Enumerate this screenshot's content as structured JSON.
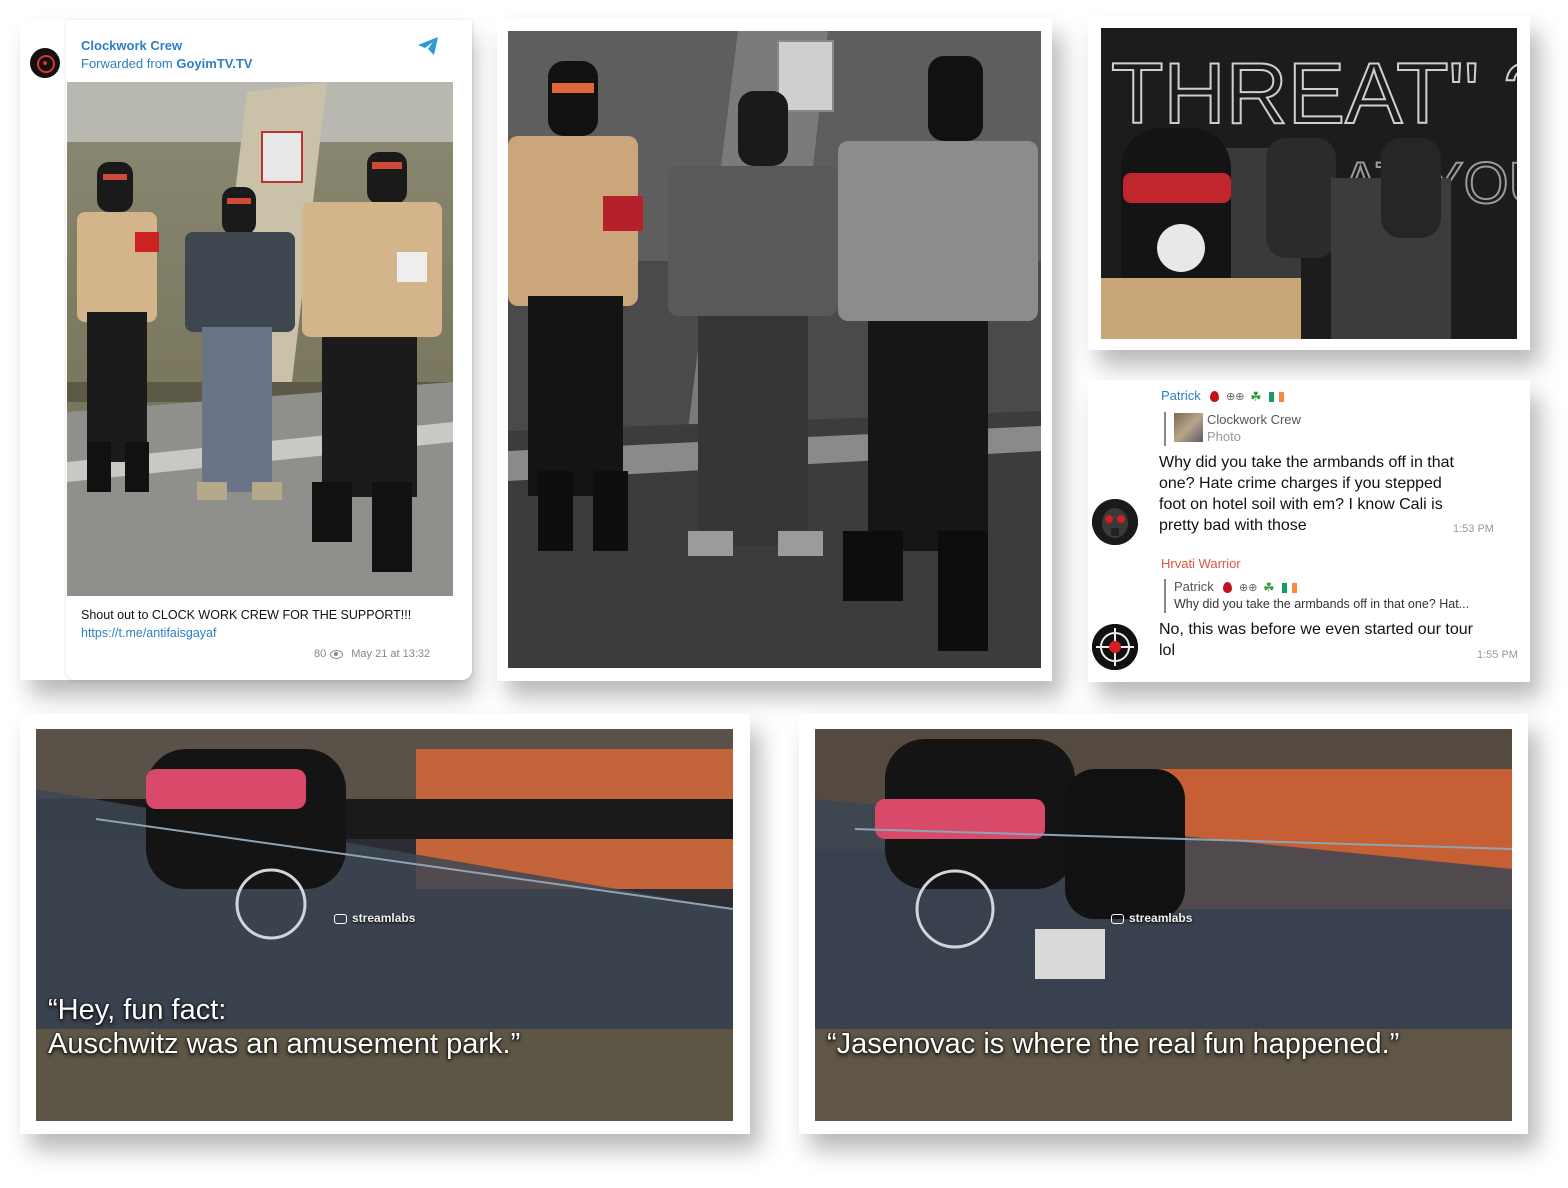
{
  "telegram_post": {
    "channel": "Clockwork Crew",
    "forwarded_prefix": "Forwarded from ",
    "forwarded_source": "GoyimTV.TV",
    "text": "Shout out to CLOCK WORK CREW FOR THE SUPPORT!!!",
    "link": "https://t.me/antifaisgayaf",
    "views": "80",
    "date": "May 21 at 13:32",
    "icons": {
      "avatar": "crosshair-avatar-icon",
      "app": "telegram-plane-icon",
      "views": "eye-icon"
    }
  },
  "photos": {
    "grayscale_group": "",
    "selfie_wall_text": "THREAT\" ?"
  },
  "chat": {
    "msg1": {
      "sender": "Patrick",
      "sender_color": "#2c7fc6",
      "sender_symbols": "⊕⊕",
      "reply_to_name": "Clockwork Crew",
      "reply_to_type": "Photo",
      "body": "Why did you take the armbands off in that one? Hate crime charges if you stepped foot on hotel soil with em? I know Cali is pretty bad with those",
      "time": "1:53 PM"
    },
    "msg2": {
      "sender": "Hrvati Warrior",
      "sender_color": "#e0543f",
      "reply_to_name": "Patrick",
      "reply_to_snippet": "Why did you take the armbands off in that one? Hat...",
      "body": "No, this was before we even started our tour lol",
      "time": "1:55 PM"
    }
  },
  "video1": {
    "watermark": "streamlabs",
    "caption_line1": "“Hey, fun fact:",
    "caption_line2": "Auschwitz was an amusement park.”"
  },
  "video2": {
    "watermark": "streamlabs",
    "caption": "“Jasenovac is where the real fun happened.”"
  }
}
